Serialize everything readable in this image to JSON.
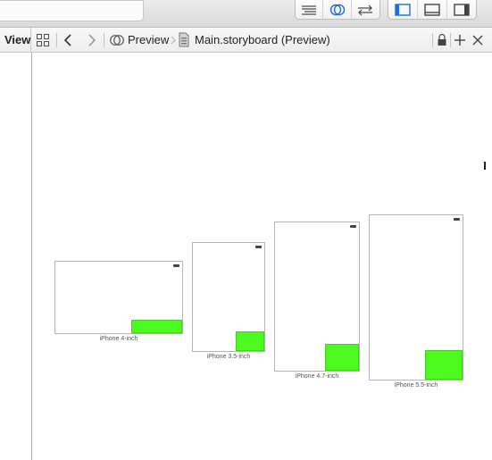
{
  "toolbar": {
    "editor_buttons": [
      "standard-editor-icon",
      "assistant-editor-icon",
      "version-editor-icon"
    ],
    "view_buttons": [
      "navigator-toggle-icon",
      "debug-area-toggle-icon",
      "utilities-toggle-icon"
    ]
  },
  "left_pane": {
    "label": "View"
  },
  "jumpbar": {
    "crumb_preview": "Preview",
    "crumb_file": "Main.storyboard (Preview)"
  },
  "devices": [
    {
      "label": "iPhone 4-inch"
    },
    {
      "label": "iPhone 3.5-inch"
    },
    {
      "label": "iPhone 4.7-inch"
    },
    {
      "label": "iPhone 5.5-inch"
    }
  ],
  "colors": {
    "green_view": "#4cfa1f",
    "selected_accent": "#1f6ed6"
  }
}
